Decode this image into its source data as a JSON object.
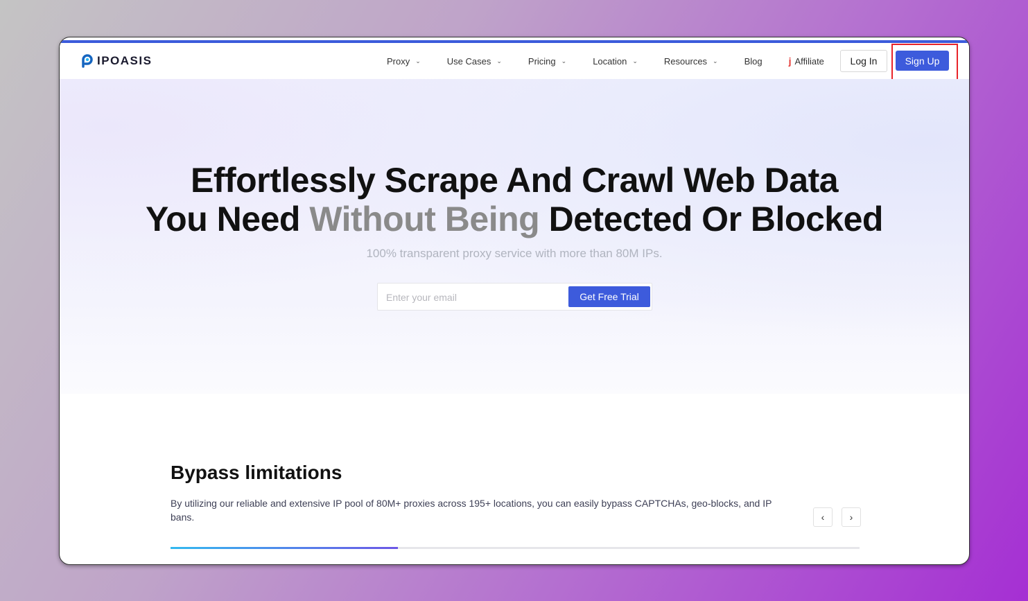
{
  "brand": {
    "logo_text": "IPOASIS"
  },
  "nav": {
    "items": [
      {
        "label": "Proxy",
        "has_dropdown": true
      },
      {
        "label": "Use Cases",
        "has_dropdown": true
      },
      {
        "label": "Pricing",
        "has_dropdown": true
      },
      {
        "label": "Location",
        "has_dropdown": true
      },
      {
        "label": "Resources",
        "has_dropdown": true
      },
      {
        "label": "Blog",
        "has_dropdown": false
      }
    ],
    "affiliate_label": "Affiliate",
    "login_label": "Log In",
    "signup_label": "Sign Up"
  },
  "hero": {
    "title_line1": "Effortlessly Scrape And Crawl Web Data",
    "title_line2_a": "You Need",
    "title_line2_highlight": "Without Being",
    "title_line2_b": "Detected Or Blocked",
    "subtitle": "100% transparent proxy service with more than 80M IPs.",
    "email_placeholder": "Enter your email",
    "cta_label": "Get Free Trial"
  },
  "feature": {
    "title": "Bypass limitations",
    "description": "By utilizing our reliable and extensive IP pool of 80M+ proxies across 195+ locations, you can easily bypass CAPTCHAs, geo-blocks, and IP bans.",
    "prev_symbol": "‹",
    "next_symbol": "›",
    "progress_percent": 33
  },
  "colors": {
    "accent": "#3d5bdc",
    "highlight_box": "#e8242a",
    "affiliate_icon": "#e53935"
  },
  "icons": [
    "logo-mark-icon",
    "chevron-down-icon",
    "affiliate-icon",
    "chevron-left-icon",
    "chevron-right-icon"
  ]
}
